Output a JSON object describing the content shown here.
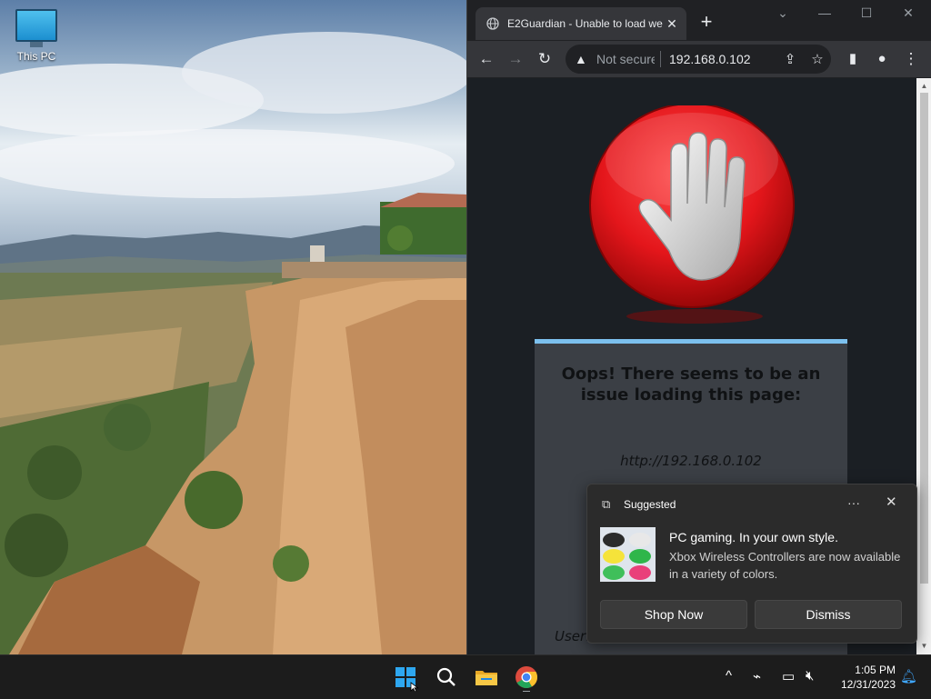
{
  "desktop": {
    "icons": [
      {
        "label": "This PC",
        "icon": "this-pc-monitor-icon"
      }
    ]
  },
  "browser": {
    "tab": {
      "title": "E2Guardian - Unable to load we",
      "icon": "globe-icon"
    },
    "window_controls": [
      "chevron-down-icon",
      "minimize-icon",
      "maximize-icon",
      "close-icon"
    ],
    "address": {
      "security_label": "Not secure",
      "url": "192.168.0.102"
    },
    "page": {
      "heading": "Oops! There seems to be an issue loading this page:",
      "requested_url": "http://192.168.0.102",
      "user_text": "User:"
    }
  },
  "notification": {
    "source": "Suggested",
    "title": "PC gaming. In your own style.",
    "body": "Xbox Wireless Controllers are now available in a variety of colors.",
    "primary_button": "Shop Now",
    "secondary_button": "Dismiss"
  },
  "taskbar": {
    "pinned": [
      "windows-start-icon",
      "search-icon",
      "file-explorer-icon",
      "chrome-icon"
    ],
    "tray": [
      "chevron-up-icon",
      "network-icon",
      "display-icon",
      "volume-mute-icon",
      "notification-bell-icon"
    ],
    "time": "1:05 PM",
    "date": "12/31/2023"
  },
  "colors": {
    "accent": "#7cc0ee",
    "stop_red": "#e4161b",
    "taskbar": "#1c1c1c"
  }
}
